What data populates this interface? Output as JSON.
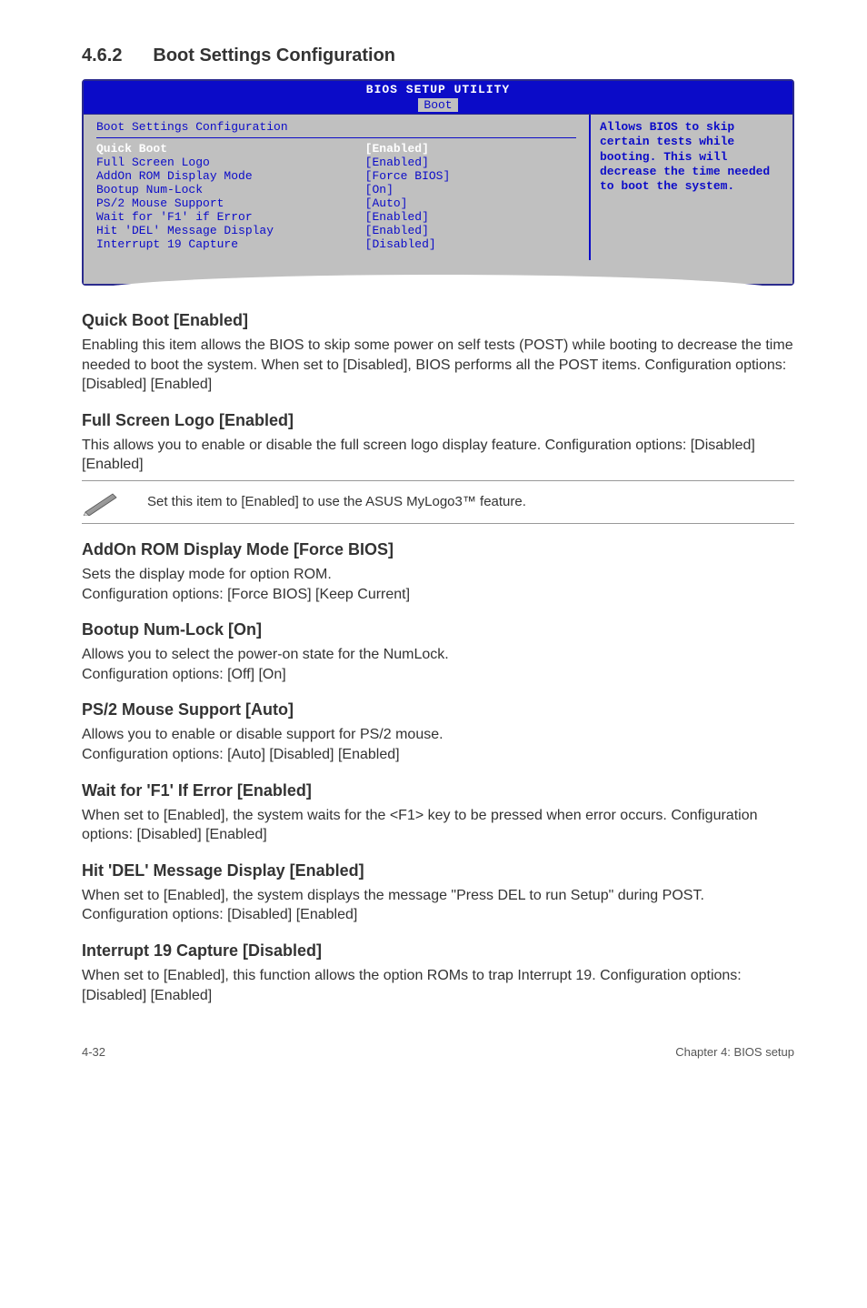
{
  "section": {
    "number": "4.6.2",
    "title": "Boot Settings Configuration"
  },
  "bios": {
    "header": "BIOS SETUP UTILITY",
    "tab": "Boot",
    "panel_title": "Boot Settings Configuration",
    "rows": [
      {
        "label": "Quick Boot",
        "value": "[Enabled]",
        "hl": true
      },
      {
        "label": "Full Screen Logo",
        "value": "[Enabled]",
        "hl": false
      },
      {
        "label": "AddOn ROM Display Mode",
        "value": "[Force BIOS]",
        "hl": false
      },
      {
        "label": "Bootup Num-Lock",
        "value": "[On]",
        "hl": false
      },
      {
        "label": "PS/2 Mouse Support",
        "value": "[Auto]",
        "hl": false
      },
      {
        "label": "Wait for 'F1' if Error",
        "value": "[Enabled]",
        "hl": false
      },
      {
        "label": "Hit 'DEL' Message Display",
        "value": "[Enabled]",
        "hl": false
      },
      {
        "label": "Interrupt 19 Capture",
        "value": "[Disabled]",
        "hl": false
      }
    ],
    "help": "Allows BIOS to skip certain tests while booting. This will decrease the time needed to boot the system."
  },
  "subs": {
    "quick": {
      "h": "Quick Boot [Enabled]",
      "p": "Enabling this item allows the BIOS to skip some power on self tests (POST) while booting to decrease the time needed to boot the system. When set to [Disabled], BIOS performs all the POST items. Configuration options: [Disabled] [Enabled]"
    },
    "logo": {
      "h": "Full Screen Logo [Enabled]",
      "p": "This allows you to enable or disable the full screen logo display feature. Configuration options: [Disabled] [Enabled]"
    },
    "note": "Set this item to [Enabled] to use the ASUS MyLogo3™ feature.",
    "addon": {
      "h": "AddOn ROM Display Mode [Force BIOS]",
      "p": "Sets the display mode for option ROM.\nConfiguration options: [Force BIOS] [Keep Current]"
    },
    "numlock": {
      "h": "Bootup Num-Lock [On]",
      "p": "Allows you to select the power-on state for the NumLock.\nConfiguration options: [Off] [On]"
    },
    "ps2": {
      "h": "PS/2 Mouse Support [Auto]",
      "p": "Allows you to enable or disable support for PS/2 mouse.\nConfiguration options: [Auto] [Disabled] [Enabled]"
    },
    "f1": {
      "h": "Wait for 'F1' If Error [Enabled]",
      "p": "When set to [Enabled], the system waits for the <F1> key to be pressed when error occurs. Configuration options: [Disabled] [Enabled]"
    },
    "del": {
      "h": "Hit 'DEL' Message Display [Enabled]",
      "p": "When set to [Enabled], the system displays the message \"Press DEL to run Setup\" during POST. Configuration options: [Disabled] [Enabled]"
    },
    "int19": {
      "h": "Interrupt 19 Capture [Disabled]",
      "p": "When set to [Enabled], this function allows the option ROMs to trap Interrupt 19. Configuration options: [Disabled] [Enabled]"
    }
  },
  "footer": {
    "left": "4-32",
    "right": "Chapter 4: BIOS setup"
  }
}
